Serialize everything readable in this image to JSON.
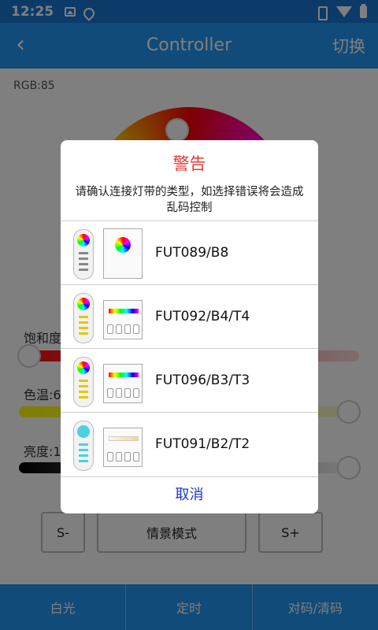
{
  "status_bar": {
    "time": "12:25"
  },
  "app_bar": {
    "back_icon": "chevron-left",
    "title": "Controller",
    "switch_label": "切换"
  },
  "main": {
    "rgb_label": "RGB:85",
    "saturation_label": "饱和度",
    "color_temp_label": "色温:6",
    "brightness_label": "亮度:1",
    "buttons": {
      "s_minus": "S-",
      "scene_mode": "情景模式",
      "s_plus": "S+"
    }
  },
  "bottom_nav": {
    "items": [
      "白光",
      "定时",
      "对码/清码"
    ]
  },
  "dialog": {
    "title": "警告",
    "message": "请确认连接灯带的类型，如选择错误将会造成乱码控制",
    "options": [
      "FUT089/B8",
      "FUT092/B4/T4",
      "FUT096/B3/T3",
      "FUT091/B2/T2"
    ],
    "cancel_label": "取消"
  },
  "colors": {
    "primary": "#2196f3",
    "status_bar": "#1976d2",
    "warning_title": "#e53935",
    "cancel_text": "#1a35c9"
  }
}
